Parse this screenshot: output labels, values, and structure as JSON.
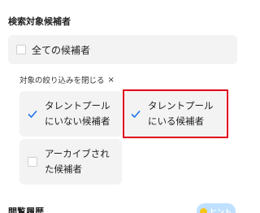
{
  "section_title": "検索対象候補者",
  "all_candidates": {
    "label": "全ての候補者",
    "checked": false
  },
  "filter_toggle": {
    "label": "対象の絞り込みを閉じる",
    "close_glyph": "×"
  },
  "options": [
    {
      "line1": "タレントプール",
      "line2": "にいない候補者",
      "checked": true
    },
    {
      "line1": "タレントプール",
      "line2": "にいる候補者",
      "checked": true
    },
    {
      "line1": "アーカイブされ",
      "line2": "た候補者",
      "checked": false
    }
  ],
  "history_title": "閲覧履歴",
  "hint_badge": {
    "label": "ヒント"
  },
  "colors": {
    "check": "#1f73e8",
    "highlight": "#e0001b",
    "badge": "#bfe1ff"
  }
}
